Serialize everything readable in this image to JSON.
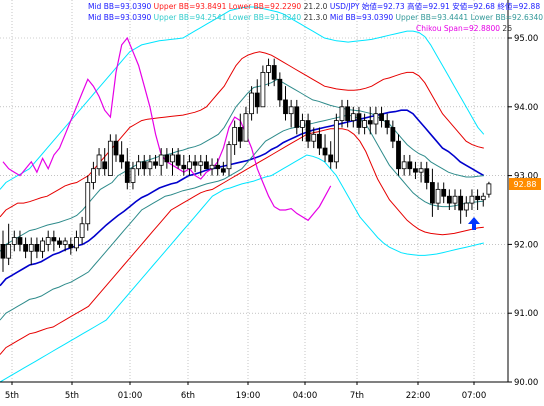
{
  "header": {
    "line1": [
      {
        "text": "Mid BB=93.0390",
        "color": "#1a1aff"
      },
      {
        "text": "Upper BB=93.8491",
        "color": "#ff1a1a"
      },
      {
        "text": "Lower BB=92.2290",
        "color": "#ff1a1a"
      },
      {
        "text": "21.2.0",
        "color": "#333333"
      },
      {
        "text": "USD/JPY 始値=92.73 高値=92.91 安値=92.68 終値=92.88",
        "color": "#1a1aff"
      }
    ],
    "line2": [
      {
        "text": "Mid BB=93.0390",
        "color": "#1a1aff"
      },
      {
        "text": "Upper BB=94.2541",
        "color": "#33cccc"
      },
      {
        "text": "Lower BB=91.8240",
        "color": "#33cccc"
      },
      {
        "text": "21.3.0",
        "color": "#333333"
      },
      {
        "text": "Mid BB=93.0390",
        "color": "#1a1aff"
      },
      {
        "text": "Upper BB=93.4441",
        "color": "#339999"
      },
      {
        "text": "Lower BB=92.6340",
        "color": "#339999"
      },
      {
        "text": "21.1.0",
        "color": "#333333"
      }
    ],
    "line3": [
      {
        "text": "Chikou Span=92.8800",
        "color": "#e600e6"
      },
      {
        "text": "26",
        "color": "#333333"
      }
    ]
  },
  "price_badge": "92.88",
  "colors": {
    "background": "#ffffff",
    "price_candle": "#000000",
    "mid_bb": "#0000cc",
    "bb_1sigma": "#2e8b8b",
    "bb_2sigma": "#e60000",
    "bb_3sigma": "#00e5ff",
    "chikou_span": "#e600e6",
    "arrow": "#0033ff",
    "grid": "#a0a0a0",
    "price_badge_bg": "#ff8c00"
  },
  "arrow_icon": "up-arrow-icon",
  "chart_data": {
    "type": "candlestick",
    "instrument": "USD/JPY",
    "ylim": [
      90.0,
      95.0
    ],
    "y_ticks": [
      "95.00",
      "94.00",
      "93.00",
      "92.00",
      "91.00",
      "90.00"
    ],
    "x_tick_labels": [
      "5th",
      "5th",
      "01:00",
      "6th",
      "19:00",
      "04:00",
      "7th",
      "22:00",
      "07:00"
    ],
    "grid": true,
    "candles": [
      [
        92.0,
        92.2,
        91.6,
        91.8
      ],
      [
        91.8,
        92.3,
        91.7,
        92.0
      ],
      [
        92.0,
        92.2,
        91.9,
        92.1
      ],
      [
        92.1,
        92.2,
        91.9,
        92.0
      ],
      [
        92.0,
        92.1,
        91.8,
        91.9
      ],
      [
        91.9,
        92.1,
        91.7,
        92.0
      ],
      [
        92.0,
        92.1,
        91.8,
        91.9
      ],
      [
        91.9,
        92.1,
        91.8,
        92.05
      ],
      [
        92.0,
        92.2,
        91.9,
        92.1
      ],
      [
        92.1,
        92.2,
        91.9,
        92.05
      ],
      [
        92.05,
        92.1,
        91.95,
        92.0
      ],
      [
        92.0,
        92.1,
        91.9,
        92.05
      ],
      [
        92.0,
        92.1,
        91.85,
        91.95
      ],
      [
        91.95,
        92.2,
        91.9,
        92.1
      ],
      [
        92.1,
        92.4,
        92.0,
        92.3
      ],
      [
        92.3,
        93.0,
        92.2,
        92.9
      ],
      [
        92.9,
        93.2,
        92.8,
        93.1
      ],
      [
        93.1,
        93.4,
        93.0,
        93.3
      ],
      [
        93.2,
        93.4,
        93.0,
        93.1
      ],
      [
        93.0,
        93.6,
        93.0,
        93.5
      ],
      [
        93.5,
        93.6,
        93.2,
        93.3
      ],
      [
        93.3,
        93.5,
        93.1,
        93.2
      ],
      [
        93.2,
        93.4,
        92.8,
        92.9
      ],
      [
        92.9,
        93.2,
        92.8,
        93.1
      ],
      [
        93.1,
        93.3,
        93.0,
        93.2
      ],
      [
        93.2,
        93.3,
        93.0,
        93.1
      ],
      [
        93.1,
        93.3,
        93.0,
        93.2
      ],
      [
        93.2,
        93.3,
        93.1,
        93.15
      ],
      [
        93.15,
        93.4,
        93.0,
        93.3
      ],
      [
        93.3,
        93.4,
        93.1,
        93.2
      ],
      [
        93.2,
        93.4,
        93.0,
        93.3
      ],
      [
        93.3,
        93.4,
        93.1,
        93.15
      ],
      [
        93.15,
        93.3,
        93.0,
        93.1
      ],
      [
        93.1,
        93.3,
        93.0,
        93.2
      ],
      [
        93.2,
        93.3,
        93.05,
        93.15
      ],
      [
        93.15,
        93.3,
        93.0,
        93.2
      ],
      [
        93.2,
        93.3,
        93.1,
        93.1
      ],
      [
        93.1,
        93.25,
        93.0,
        93.15
      ],
      [
        93.15,
        93.25,
        93.0,
        93.1
      ],
      [
        93.1,
        93.2,
        93.0,
        93.05
      ],
      [
        93.1,
        93.5,
        93.0,
        93.45
      ],
      [
        93.45,
        93.8,
        93.3,
        93.7
      ],
      [
        93.7,
        93.9,
        93.4,
        93.5
      ],
      [
        93.5,
        94.0,
        93.5,
        93.9
      ],
      [
        93.9,
        94.3,
        93.8,
        94.2
      ],
      [
        94.2,
        94.4,
        93.9,
        94.0
      ],
      [
        94.0,
        94.6,
        94.0,
        94.5
      ],
      [
        94.5,
        94.7,
        94.3,
        94.6
      ],
      [
        94.6,
        94.7,
        94.3,
        94.4
      ],
      [
        94.4,
        94.5,
        94.0,
        94.1
      ],
      [
        94.1,
        94.3,
        93.8,
        93.9
      ],
      [
        93.9,
        94.1,
        93.7,
        94.0
      ],
      [
        94.0,
        94.1,
        93.6,
        93.7
      ],
      [
        93.7,
        93.9,
        93.5,
        93.8
      ],
      [
        93.8,
        93.9,
        93.4,
        93.5
      ],
      [
        93.5,
        93.7,
        93.4,
        93.6
      ],
      [
        93.6,
        93.7,
        93.3,
        93.4
      ],
      [
        93.4,
        93.6,
        93.2,
        93.3
      ],
      [
        93.3,
        93.5,
        93.1,
        93.2
      ],
      [
        93.2,
        93.9,
        93.1,
        93.8
      ],
      [
        93.8,
        94.1,
        93.7,
        94.0
      ],
      [
        94.0,
        94.1,
        93.7,
        93.8
      ],
      [
        93.8,
        94.0,
        93.7,
        93.9
      ],
      [
        93.9,
        94.0,
        93.6,
        93.7
      ],
      [
        93.7,
        93.9,
        93.6,
        93.8
      ],
      [
        93.8,
        94.0,
        93.6,
        93.75
      ],
      [
        93.75,
        94.0,
        93.6,
        93.9
      ],
      [
        93.9,
        94.0,
        93.7,
        93.8
      ],
      [
        93.8,
        93.9,
        93.6,
        93.7
      ],
      [
        93.7,
        93.8,
        93.4,
        93.5
      ],
      [
        93.5,
        93.6,
        93.0,
        93.1
      ],
      [
        93.1,
        93.3,
        93.0,
        93.2
      ],
      [
        93.2,
        93.3,
        93.0,
        93.1
      ],
      [
        93.1,
        93.2,
        92.95,
        93.05
      ],
      [
        93.05,
        93.2,
        92.9,
        93.1
      ],
      [
        93.1,
        93.2,
        92.8,
        92.9
      ],
      [
        92.9,
        93.1,
        92.4,
        92.6
      ],
      [
        92.6,
        92.9,
        92.5,
        92.8
      ],
      [
        92.8,
        92.9,
        92.6,
        92.7
      ],
      [
        92.7,
        92.8,
        92.5,
        92.6
      ],
      [
        92.6,
        92.8,
        92.5,
        92.7
      ],
      [
        92.7,
        92.8,
        92.3,
        92.5
      ],
      [
        92.5,
        92.7,
        92.4,
        92.6
      ],
      [
        92.6,
        92.8,
        92.5,
        92.7
      ],
      [
        92.7,
        92.8,
        92.5,
        92.65
      ],
      [
        92.65,
        92.75,
        92.55,
        92.7
      ],
      [
        92.73,
        92.91,
        92.68,
        92.88
      ]
    ],
    "series": [
      {
        "name": "Mid BB",
        "band": "mid",
        "values": [
          91.4,
          91.5,
          91.55,
          91.6,
          91.65,
          91.7,
          91.72,
          91.75,
          91.8,
          91.85,
          91.88,
          91.92,
          91.95,
          91.98,
          92.0,
          92.05,
          92.12,
          92.2,
          92.28,
          92.35,
          92.42,
          92.48,
          92.55,
          92.62,
          92.68,
          92.72,
          92.77,
          92.82,
          92.85,
          92.88,
          92.9,
          92.95,
          93.0,
          93.02,
          93.05,
          93.08,
          93.1,
          93.12,
          93.14,
          93.16,
          93.18,
          93.2,
          93.22,
          93.25,
          93.28,
          93.32,
          93.38,
          93.42,
          93.48,
          93.52,
          93.56,
          93.6,
          93.63,
          93.66,
          93.68,
          93.7,
          93.72,
          93.74,
          93.76,
          93.78,
          93.8,
          93.82,
          93.84,
          93.86,
          93.88,
          93.9,
          93.92,
          93.93,
          93.95,
          93.95,
          93.9,
          93.8,
          93.7,
          93.6,
          93.5,
          93.4,
          93.35,
          93.28,
          93.2,
          93.15,
          93.1,
          93.05,
          93.0
        ]
      },
      {
        "name": "Upper BB",
        "band": "+1σ",
        "values": [
          91.9,
          92.0,
          92.05,
          92.1,
          92.15,
          92.2,
          92.22,
          92.25,
          92.28,
          92.3,
          92.32,
          92.35,
          92.38,
          92.42,
          92.5,
          92.6,
          92.7,
          92.8,
          92.85,
          92.9,
          93.0,
          93.05,
          93.1,
          93.15,
          93.2,
          93.22,
          93.25,
          93.28,
          93.3,
          93.32,
          93.35,
          93.37,
          93.4,
          93.42,
          93.45,
          93.5,
          93.55,
          93.6,
          93.7,
          93.85,
          94.0,
          94.1,
          94.2,
          94.28,
          94.3,
          94.32,
          94.35,
          94.4,
          94.35,
          94.3,
          94.25,
          94.2,
          94.15,
          94.1,
          94.08,
          94.05,
          94.02,
          94.0,
          93.98,
          93.96,
          93.95,
          93.94,
          93.92,
          93.9,
          93.85,
          93.8,
          93.75,
          93.65,
          93.55,
          93.45,
          93.38,
          93.32,
          93.28,
          93.2,
          93.15,
          93.1,
          93.05,
          93.02,
          93.0,
          92.98,
          92.98,
          92.99,
          93.0
        ]
      },
      {
        "name": "Lower BB",
        "band": "-1σ",
        "values": [
          90.9,
          91.0,
          91.05,
          91.1,
          91.15,
          91.2,
          91.22,
          91.25,
          91.3,
          91.35,
          91.38,
          91.42,
          91.45,
          91.5,
          91.55,
          91.6,
          91.7,
          91.8,
          91.9,
          92.0,
          92.1,
          92.2,
          92.3,
          92.4,
          92.5,
          92.55,
          92.6,
          92.65,
          92.7,
          92.72,
          92.75,
          92.78,
          92.8,
          92.82,
          92.85,
          92.88,
          92.9,
          92.92,
          92.95,
          93.0,
          93.05,
          93.1,
          93.2,
          93.3,
          93.4,
          93.5,
          93.55,
          93.6,
          93.65,
          93.68,
          93.7,
          93.72,
          93.74,
          93.76,
          93.78,
          93.8,
          93.82,
          93.84,
          93.86,
          93.88,
          93.86,
          93.82,
          93.75,
          93.6,
          93.45,
          93.3,
          93.15,
          93.05,
          92.95,
          92.85,
          92.75,
          92.68,
          92.62,
          92.58,
          92.56,
          92.55,
          92.55,
          92.56,
          92.58,
          92.6,
          92.61,
          92.62,
          92.63
        ]
      },
      {
        "name": "Upper BB",
        "band": "+2σ",
        "values": [
          92.4,
          92.5,
          92.55,
          92.6,
          92.6,
          92.62,
          92.65,
          92.68,
          92.7,
          92.75,
          92.8,
          92.85,
          92.88,
          92.9,
          92.95,
          93.0,
          93.1,
          93.2,
          93.3,
          93.4,
          93.5,
          93.6,
          93.7,
          93.75,
          93.8,
          93.82,
          93.83,
          93.84,
          93.85,
          93.86,
          93.87,
          93.88,
          93.9,
          93.92,
          93.95,
          94.0,
          94.1,
          94.2,
          94.3,
          94.45,
          94.6,
          94.7,
          94.75,
          94.78,
          94.8,
          94.78,
          94.75,
          94.7,
          94.65,
          94.6,
          94.55,
          94.5,
          94.45,
          94.4,
          94.35,
          94.3,
          94.28,
          94.26,
          94.25,
          94.24,
          94.24,
          94.25,
          94.27,
          94.3,
          94.35,
          94.4,
          94.42,
          94.45,
          94.48,
          94.5,
          94.5,
          94.45,
          94.35,
          94.2,
          94.05,
          93.9,
          93.8,
          93.7,
          93.6,
          93.5,
          93.45,
          93.42,
          93.4
        ]
      },
      {
        "name": "Lower BB",
        "band": "-2σ",
        "values": [
          90.4,
          90.5,
          90.55,
          90.6,
          90.65,
          90.7,
          90.72,
          90.75,
          90.78,
          90.8,
          90.85,
          90.9,
          90.95,
          91.0,
          91.05,
          91.1,
          91.2,
          91.3,
          91.4,
          91.5,
          91.6,
          91.7,
          91.8,
          91.9,
          92.0,
          92.1,
          92.2,
          92.3,
          92.4,
          92.5,
          92.55,
          92.6,
          92.65,
          92.7,
          92.75,
          92.78,
          92.8,
          92.85,
          92.9,
          92.95,
          93.0,
          93.05,
          93.1,
          93.15,
          93.2,
          93.25,
          93.3,
          93.35,
          93.4,
          93.45,
          93.5,
          93.55,
          93.6,
          93.62,
          93.64,
          93.66,
          93.68,
          93.68,
          93.68,
          93.66,
          93.6,
          93.5,
          93.35,
          93.15,
          92.95,
          92.8,
          92.65,
          92.55,
          92.45,
          92.35,
          92.28,
          92.22,
          92.18,
          92.16,
          92.15,
          92.14,
          92.15,
          92.16,
          92.18,
          92.2,
          92.22,
          92.24,
          92.25
        ]
      },
      {
        "name": "Upper BB",
        "band": "+3σ",
        "values": [
          92.8,
          92.9,
          92.95,
          93.0,
          93.05,
          93.1,
          93.2,
          93.3,
          93.4,
          93.5,
          93.6,
          93.7,
          93.8,
          93.9,
          94.0,
          94.1,
          94.2,
          94.3,
          94.4,
          94.5,
          94.6,
          94.7,
          94.8,
          94.85,
          94.9,
          94.92,
          94.94,
          94.96,
          94.97,
          94.98,
          94.99,
          95.0,
          95.05,
          95.1,
          95.15,
          95.2,
          95.25,
          95.3,
          95.35,
          95.4,
          95.42,
          95.44,
          95.45,
          95.45,
          95.44,
          95.42,
          95.4,
          95.38,
          95.35,
          95.3,
          95.25,
          95.2,
          95.15,
          95.1,
          95.05,
          95.0,
          94.98,
          94.96,
          94.95,
          94.94,
          94.95,
          94.96,
          94.97,
          94.98,
          95.0,
          95.02,
          95.04,
          95.06,
          95.08,
          95.1,
          95.1,
          95.08,
          95.02,
          94.9,
          94.75,
          94.6,
          94.45,
          94.3,
          94.15,
          94.0,
          93.85,
          93.7,
          93.6
        ]
      },
      {
        "name": "Lower BB",
        "band": "-3σ",
        "values": [
          90.0,
          90.05,
          90.1,
          90.15,
          90.2,
          90.25,
          90.3,
          90.35,
          90.4,
          90.45,
          90.5,
          90.55,
          90.6,
          90.65,
          90.7,
          90.75,
          90.8,
          90.85,
          90.9,
          91.0,
          91.1,
          91.2,
          91.3,
          91.4,
          91.5,
          91.6,
          91.7,
          91.8,
          91.9,
          92.0,
          92.1,
          92.2,
          92.3,
          92.4,
          92.5,
          92.6,
          92.7,
          92.75,
          92.8,
          92.82,
          92.85,
          92.88,
          92.9,
          92.92,
          92.95,
          92.98,
          93.0,
          93.05,
          93.1,
          93.15,
          93.2,
          93.25,
          93.3,
          93.28,
          93.25,
          93.2,
          93.1,
          93.0,
          92.85,
          92.7,
          92.55,
          92.4,
          92.3,
          92.2,
          92.1,
          92.02,
          91.96,
          91.92,
          91.88,
          91.86,
          91.85,
          91.84,
          91.84,
          91.85,
          91.86,
          91.88,
          91.9,
          91.92,
          91.94,
          91.96,
          91.98,
          92.0,
          92.02
        ]
      },
      {
        "name": "Chikou Span",
        "band": "chikou",
        "values": [
          93.2,
          93.1,
          93.05,
          93.0,
          93.1,
          93.2,
          93.05,
          93.25,
          93.1,
          93.3,
          93.4,
          93.6,
          93.8,
          94.0,
          94.2,
          94.4,
          94.3,
          94.15,
          93.95,
          93.85,
          94.5,
          94.9,
          95.0,
          94.8,
          94.6,
          94.3,
          94.0,
          93.6,
          93.3,
          93.2,
          93.15,
          93.1,
          93.05,
          93.1,
          93.0,
          92.95,
          93.05,
          93.1,
          93.2,
          93.4,
          93.7,
          93.85,
          93.8,
          93.6,
          93.4,
          93.1,
          92.9,
          92.7,
          92.55,
          92.5,
          92.5,
          92.52,
          92.45,
          92.4,
          92.35,
          92.45,
          92.55,
          92.7,
          92.85
        ]
      }
    ]
  }
}
